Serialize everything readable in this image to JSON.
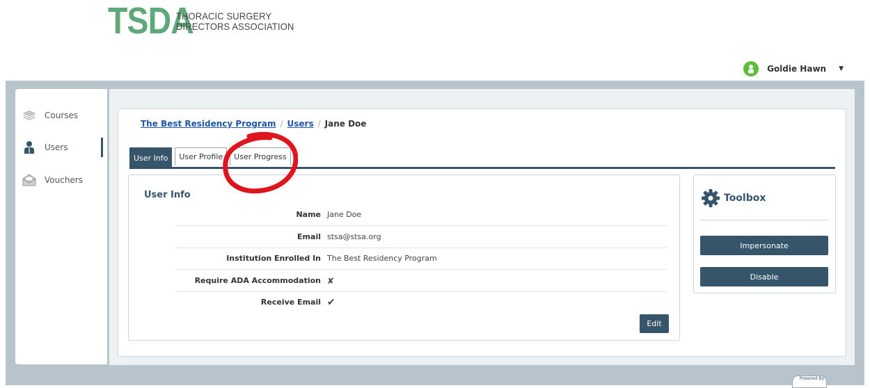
{
  "header": {
    "logo_mark": "TSDA",
    "logo_line1": "THORACIC SURGERY",
    "logo_line2": "DIRECTORS ASSOCIATION",
    "user_name": "Goldie Hawn"
  },
  "sidebar": {
    "items": [
      {
        "label": "Courses",
        "icon": "courses-icon"
      },
      {
        "label": "Users",
        "icon": "user-icon",
        "active": true
      },
      {
        "label": "Vouchers",
        "icon": "voucher-icon"
      }
    ]
  },
  "breadcrumb": {
    "program": "The Best Residency Program",
    "users": "Users",
    "current": "Jane Doe",
    "separator": "/"
  },
  "tabs": [
    {
      "label": "User Info",
      "active": true
    },
    {
      "label": "User Profile"
    },
    {
      "label": "User Progress"
    }
  ],
  "user_info": {
    "title": "User Info",
    "rows": [
      {
        "label": "Name",
        "value": "Jane Doe"
      },
      {
        "label": "Email",
        "value": "stsa@stsa.org"
      },
      {
        "label": "Institution Enrolled In",
        "value": "The Best Residency Program"
      },
      {
        "label": "Require ADA Accommodation",
        "value": "✘"
      },
      {
        "label": "Receive Email",
        "value": "✔"
      }
    ],
    "edit_label": "Edit"
  },
  "toolbox": {
    "title": "Toolbox",
    "impersonate_label": "Impersonate",
    "disable_label": "Disable"
  },
  "footer": {
    "powered": "Powered By"
  },
  "colors": {
    "brand_green": "#5fa87a",
    "primary": "#36556b",
    "link": "#1f57a4",
    "annotation": "#e0141c"
  }
}
